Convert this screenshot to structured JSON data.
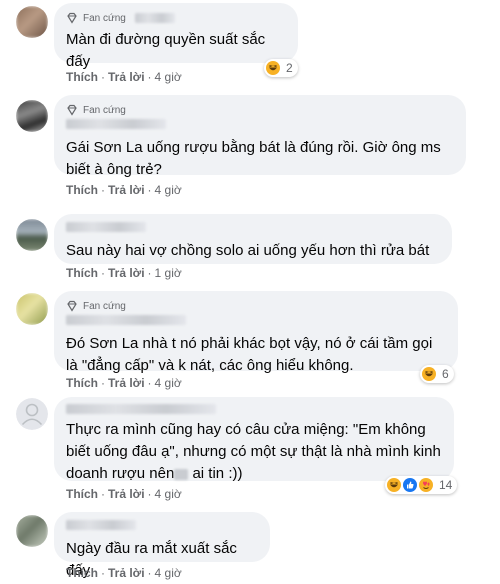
{
  "labels": {
    "fan_badge": "Fan cứng",
    "like": "Thích",
    "reply": "Trả lời",
    "separator": "·"
  },
  "comments": [
    {
      "text": "Màn đi đường quyền suất sắc đấy",
      "time": "4 giờ",
      "reaction_count": "2"
    },
    {
      "text": "Gái Sơn La uống rượu bằng bát là đúng rồi. Giờ ông ms biết à ông trẻ?",
      "time": "4 giờ"
    },
    {
      "text": "Sau này hai vợ chồng solo ai uống yếu hơn thì rửa bát",
      "time": "1 giờ"
    },
    {
      "text": "Đó Sơn La nhà t nó phải khác bọt vậy, nó ở cái tầm gọi là \"đẳng cấp\" và k nát, các ông hiểu không.",
      "time": "4 giờ",
      "reaction_count": "6"
    },
    {
      "text_a": "Thực ra mình cũng hay có câu cửa miệng: \"Em không biết uống đâu ạ\", nhưng có một sự thật là nhà mình kinh doanh rượu nên",
      "text_b": " ai tin :))",
      "time": "4 giờ",
      "reaction_count": "14"
    },
    {
      "text": "Ngày đầu ra mắt xuất sắc đấy",
      "time": "4 giờ"
    }
  ],
  "colors": {
    "bubble": "#f0f2f5",
    "meta": "#65676b",
    "haha": "#f7b125",
    "love": "#f33e58",
    "like": "#1877f2"
  },
  "icons": [
    "fan-badge-icon",
    "haha-reaction-icon",
    "love-reaction-icon",
    "like-reaction-icon",
    "default-avatar-icon"
  ]
}
